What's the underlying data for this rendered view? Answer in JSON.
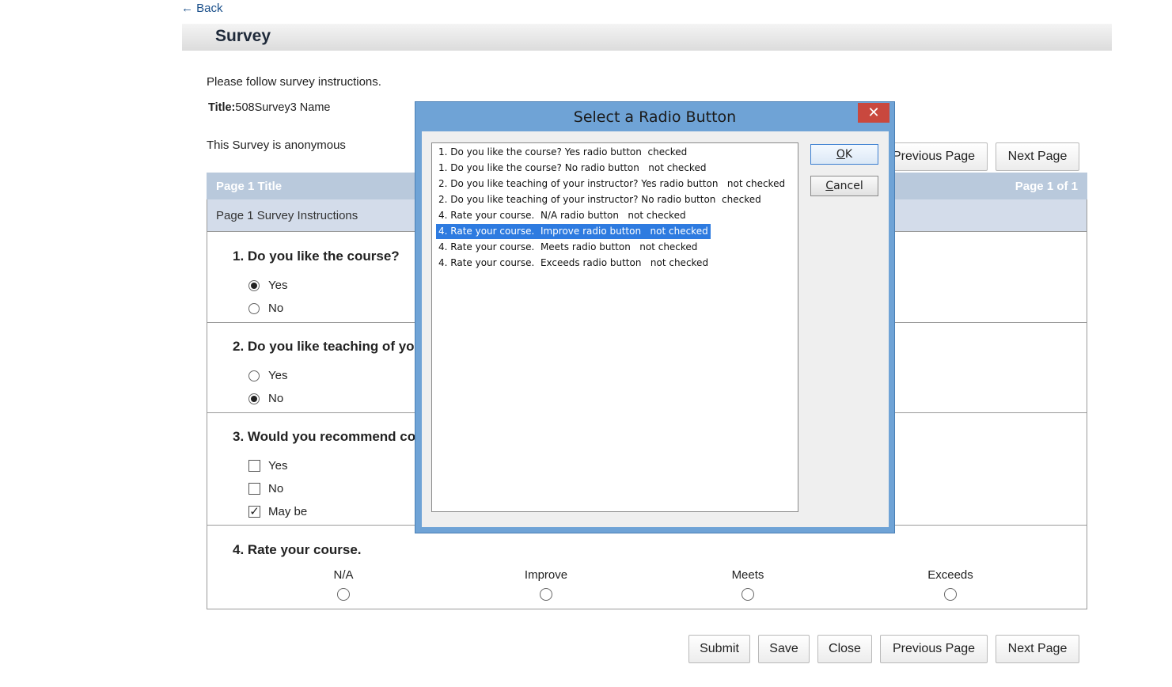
{
  "nav": {
    "back": "← Back"
  },
  "header": {
    "title": "Survey"
  },
  "survey": {
    "instructions": "Please follow survey instructions.",
    "title_label": "Title:",
    "title_value": "508Survey3 Name",
    "anonymous": "This Survey is anonymous"
  },
  "top_buttons": {
    "previous": "Previous Page",
    "next": "Next Page"
  },
  "page": {
    "title": "Page 1 Title",
    "count": "Page 1 of 1",
    "instructions": "Page 1 Survey Instructions"
  },
  "questions": [
    {
      "title": "1. Do you like the course?",
      "options": [
        {
          "label": "Yes",
          "checked": true
        },
        {
          "label": "No",
          "checked": false
        }
      ]
    },
    {
      "title": "2. Do you like teaching of your",
      "options": [
        {
          "label": "Yes",
          "checked": false
        },
        {
          "label": "No",
          "checked": true
        }
      ]
    },
    {
      "title": "3. Would you recommend cour",
      "options": [
        {
          "label": "Yes",
          "checked": false
        },
        {
          "label": "No",
          "checked": false
        },
        {
          "label": "May be",
          "checked": true
        }
      ]
    },
    {
      "title": "4. Rate your course.",
      "scale": [
        "N/A",
        "Improve",
        "Meets",
        "Exceeds"
      ]
    }
  ],
  "bottom_buttons": {
    "submit": "Submit",
    "save": "Save",
    "close": "Close",
    "previous": "Previous Page",
    "next": "Next Page"
  },
  "dialog": {
    "title": "Select a Radio Button",
    "close": "✕",
    "ok_key": "O",
    "ok_rest": "K",
    "cancel_key": "C",
    "cancel_rest": "ancel",
    "items": [
      "1. Do you like the course? Yes radio button  checked",
      "1. Do you like the course? No radio button   not checked",
      "2. Do you like teaching of your instructor? Yes radio button   not checked",
      "2. Do you like teaching of your instructor? No radio button  checked",
      "4. Rate your course.  N/A radio button   not checked",
      "4. Rate your course.  Improve radio button   not checked",
      "4. Rate your course.  Meets radio button   not checked",
      "4. Rate your course.  Exceeds radio button   not checked"
    ],
    "selected_index": 5
  }
}
